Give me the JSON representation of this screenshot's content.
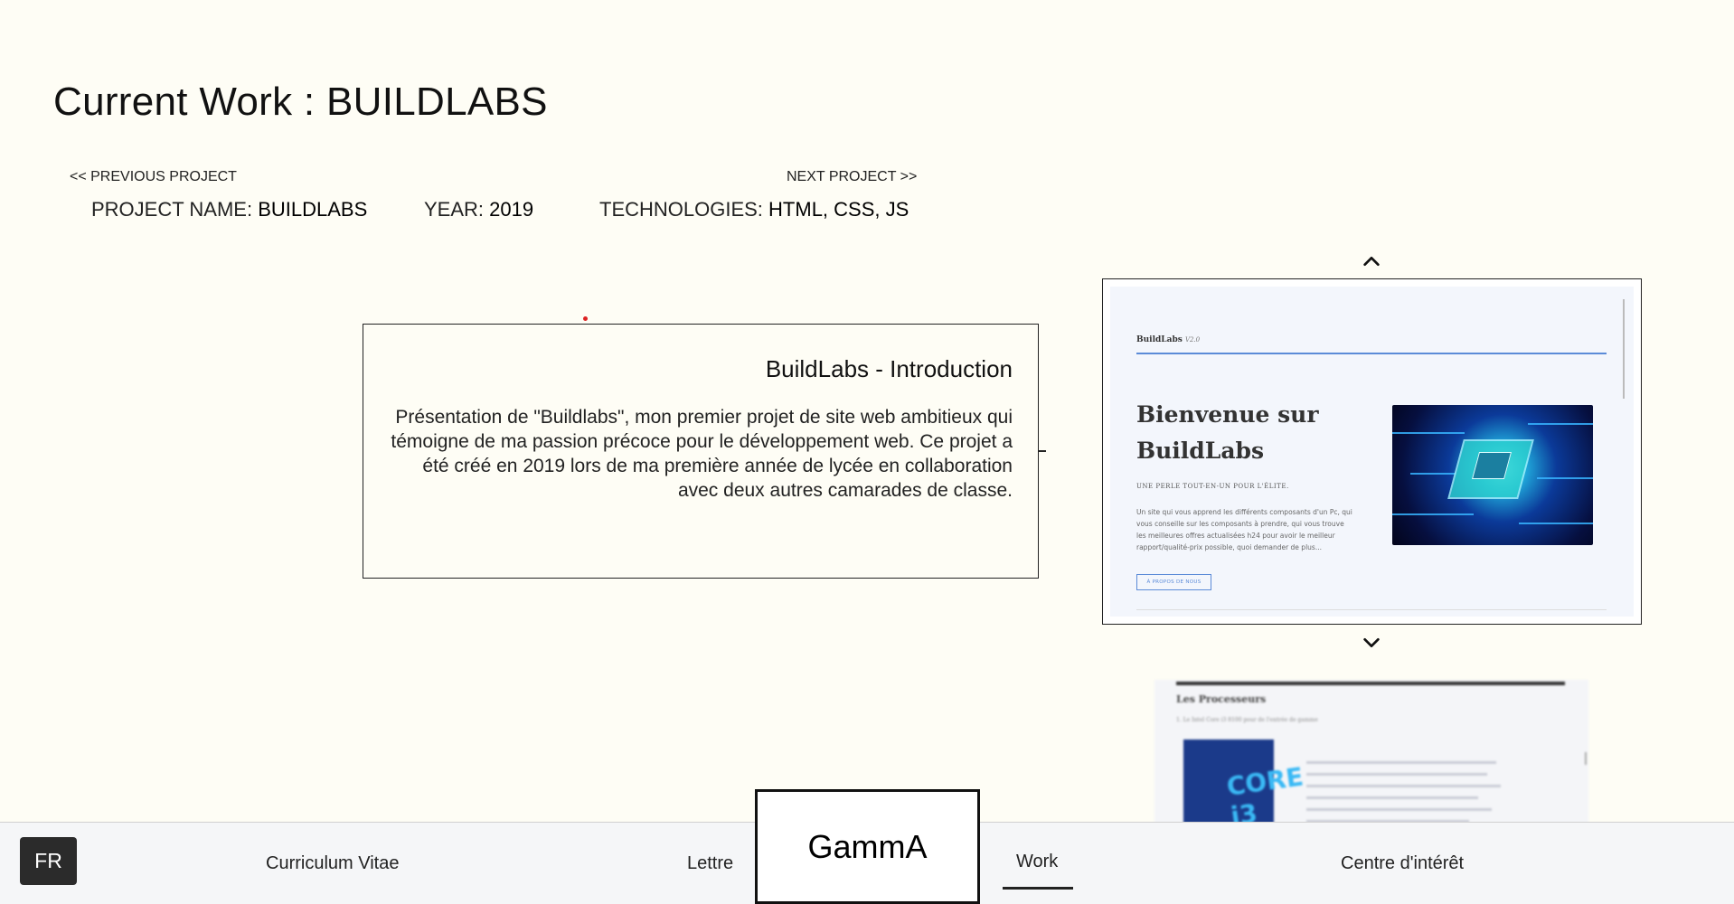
{
  "header": {
    "title": "Current Work : BUILDLABS",
    "prev_project": "<< PREVIOUS PROJECT",
    "next_project": "NEXT PROJECT >>"
  },
  "meta": {
    "name_label": "PROJECT NAME:",
    "name_value": "BUILDLABS",
    "year_label": "YEAR:",
    "year_value": "2019",
    "tech_label": "TECHNOLOGIES:",
    "tech_value": "HTML, CSS, JS"
  },
  "info": {
    "title": "BuildLabs - Introduction",
    "text": "Présentation de \"Buildlabs\", mon premier projet de site web ambitieux qui témoigne de ma passion précoce pour le développement web. Ce projet a été créé en 2019 lors de ma première année de lycée en collaboration avec deux autres camarades de classe."
  },
  "carousel": {
    "up_icon": "chevron-up-icon",
    "down_icon": "chevron-down-icon",
    "current_slide": {
      "logo": "BuildLabs",
      "version": "V2.0",
      "heading_line1": "Bienvenue sur",
      "heading_line2": "BuildLabs",
      "tagline": "UNE PERLE TOUT-EN-UN POUR L'ÉLITE.",
      "text": "Un site qui vous apprend les différents composants d'un Pc, qui vous conseille sur les composants à prendre, qui vous trouve les meilleures offres actualisées h24 pour avoir le meilleur rapport/qualité-prix possible, quoi demander de plus...",
      "button": "À PROPOS DE NOUS"
    },
    "next_slide": {
      "title": "Les Processeurs",
      "subtitle": "1. Le Intel Core i3 8100 pour de l'entrée de gamme",
      "box_label": "CORE i3"
    }
  },
  "bottom_nav": {
    "lang": "FR",
    "items": [
      "Curriculum Vitae",
      "Lettre",
      "Work",
      "Centre d'intérêt"
    ],
    "active": "Work",
    "logo": "GammA"
  }
}
